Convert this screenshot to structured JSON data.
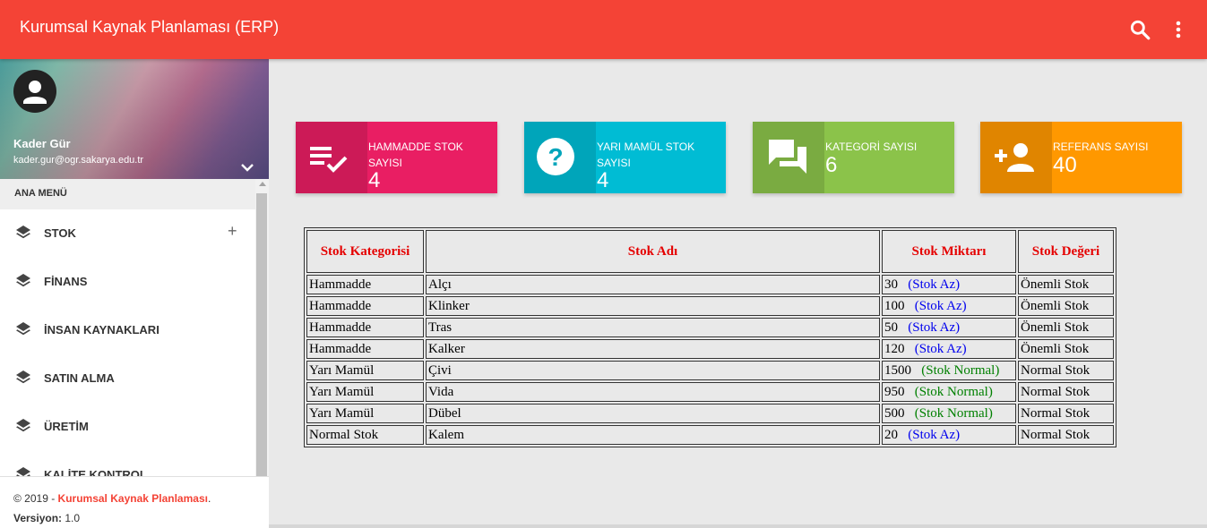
{
  "app": {
    "title": "Kurumsal Kaynak Planlaması (ERP)"
  },
  "colors": {
    "header": "#f44336",
    "pink": "#e91e63",
    "cyan": "#00bcd4",
    "green": "#8bc34a",
    "orange": "#ff9800"
  },
  "profile": {
    "name": "Kader Gür",
    "email": "kader.gur@ogr.sakarya.edu.tr"
  },
  "sidebar": {
    "menu_header": "ANA MENÜ",
    "items": [
      {
        "label": "STOK",
        "icon": "layers-icon",
        "expandable": "+"
      },
      {
        "label": "FİNANS",
        "icon": "layers-icon"
      },
      {
        "label": "İNSAN KAYNAKLARI",
        "icon": "layers-icon"
      },
      {
        "label": "SATIN ALMA",
        "icon": "layers-icon"
      },
      {
        "label": "ÜRETİM",
        "icon": "layers-icon"
      },
      {
        "label": "KALİTE KONTROL",
        "icon": "layers-icon"
      }
    ]
  },
  "footer": {
    "copyright_prefix": "© 2019 - ",
    "brand": "Kurumsal Kaynak Planlaması",
    "brand_suffix": ".",
    "version_label": "Versiyon:",
    "version_value": " 1.0"
  },
  "info_boxes": [
    {
      "label": "HAMMADDE STOK SAYISI",
      "value": "4",
      "icon": "playlist-check-icon",
      "color": "#e91e63"
    },
    {
      "label": "YARI MAMÜL STOK SAYISI",
      "value": "4",
      "icon": "help-icon",
      "color": "#00bcd4"
    },
    {
      "label": "KATEGORİ SAYISI",
      "value": "6",
      "icon": "forum-icon",
      "color": "#8bc34a"
    },
    {
      "label": "REFERANS SAYISI",
      "value": "40",
      "icon": "person-add-icon",
      "color": "#ff9800"
    }
  ],
  "table": {
    "headers": [
      "Stok Kategorisi",
      "Stok Adı",
      "Stok Miktarı",
      "Stok Değeri"
    ],
    "rows": [
      {
        "category": "Hammadde",
        "name": "Alçı",
        "qty": "30",
        "status": "(Stok Az)",
        "value": "Önemli Stok"
      },
      {
        "category": "Hammadde",
        "name": "Klinker",
        "qty": "100",
        "status": "(Stok Az)",
        "value": "Önemli Stok"
      },
      {
        "category": "Hammadde",
        "name": "Tras",
        "qty": "50",
        "status": "(Stok Az)",
        "value": "Önemli Stok"
      },
      {
        "category": "Hammadde",
        "name": "Kalker",
        "qty": "120",
        "status": "(Stok Az)",
        "value": "Önemli Stok"
      },
      {
        "category": "Yarı Mamül",
        "name": "Çivi",
        "qty": "1500",
        "status": "(Stok Normal)",
        "value": "Normal Stok"
      },
      {
        "category": "Yarı Mamül",
        "name": "Vida",
        "qty": "950",
        "status": "(Stok Normal)",
        "value": "Normal Stok"
      },
      {
        "category": "Yarı Mamül",
        "name": "Dübel",
        "qty": "500",
        "status": "(Stok Normal)",
        "value": "Normal Stok"
      },
      {
        "category": "Normal Stok",
        "name": "Kalem",
        "qty": "20",
        "status": "(Stok Az)",
        "value": "Normal Stok"
      }
    ]
  }
}
